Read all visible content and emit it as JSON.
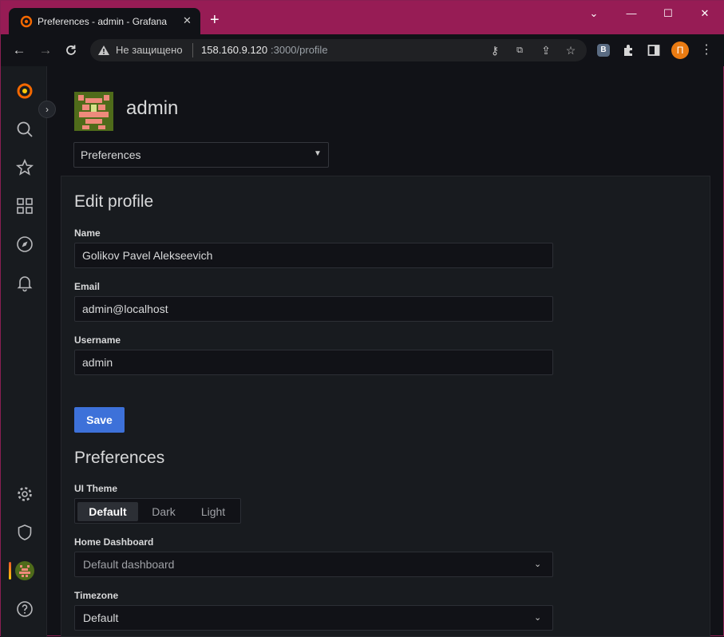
{
  "browser": {
    "tab_title": "Preferences - admin - Grafana",
    "tab_close": "✕",
    "new_tab": "+",
    "window_controls": {
      "minimize": "⌄",
      "restore": "—",
      "maximize": "☐",
      "close": "✕"
    },
    "address": {
      "security_label": "Не защищено",
      "url_host": "158.160.9.120",
      "url_rest": ":3000/profile"
    },
    "extensions": {
      "vk": "B"
    },
    "profile_initial": "П"
  },
  "sidebar": {
    "items": [
      {
        "icon": "grafana-logo-icon"
      },
      {
        "icon": "search-icon"
      },
      {
        "icon": "star-icon"
      },
      {
        "icon": "dashboards-icon"
      },
      {
        "icon": "explore-icon"
      },
      {
        "icon": "alerting-icon"
      },
      {
        "icon": "gear-icon"
      },
      {
        "icon": "shield-icon"
      },
      {
        "icon": "user-avatar-icon"
      },
      {
        "icon": "help-icon"
      }
    ]
  },
  "profile": {
    "title": "admin",
    "tab_select": "Preferences"
  },
  "edit_profile": {
    "heading": "Edit profile",
    "name_label": "Name",
    "name_value": "Golikov Pavel Alekseevich",
    "email_label": "Email",
    "email_value": "admin@localhost",
    "username_label": "Username",
    "username_value": "admin",
    "save_label": "Save"
  },
  "preferences": {
    "heading": "Preferences",
    "theme_label": "UI Theme",
    "theme_options": [
      "Default",
      "Dark",
      "Light"
    ],
    "theme_selected": "Default",
    "home_label": "Home Dashboard",
    "home_placeholder": "Default dashboard",
    "timezone_label": "Timezone",
    "timezone_value": "Default"
  },
  "colors": {
    "titlebar": "#971c55",
    "primary_button": "#3d71d9",
    "background": "#111217"
  }
}
